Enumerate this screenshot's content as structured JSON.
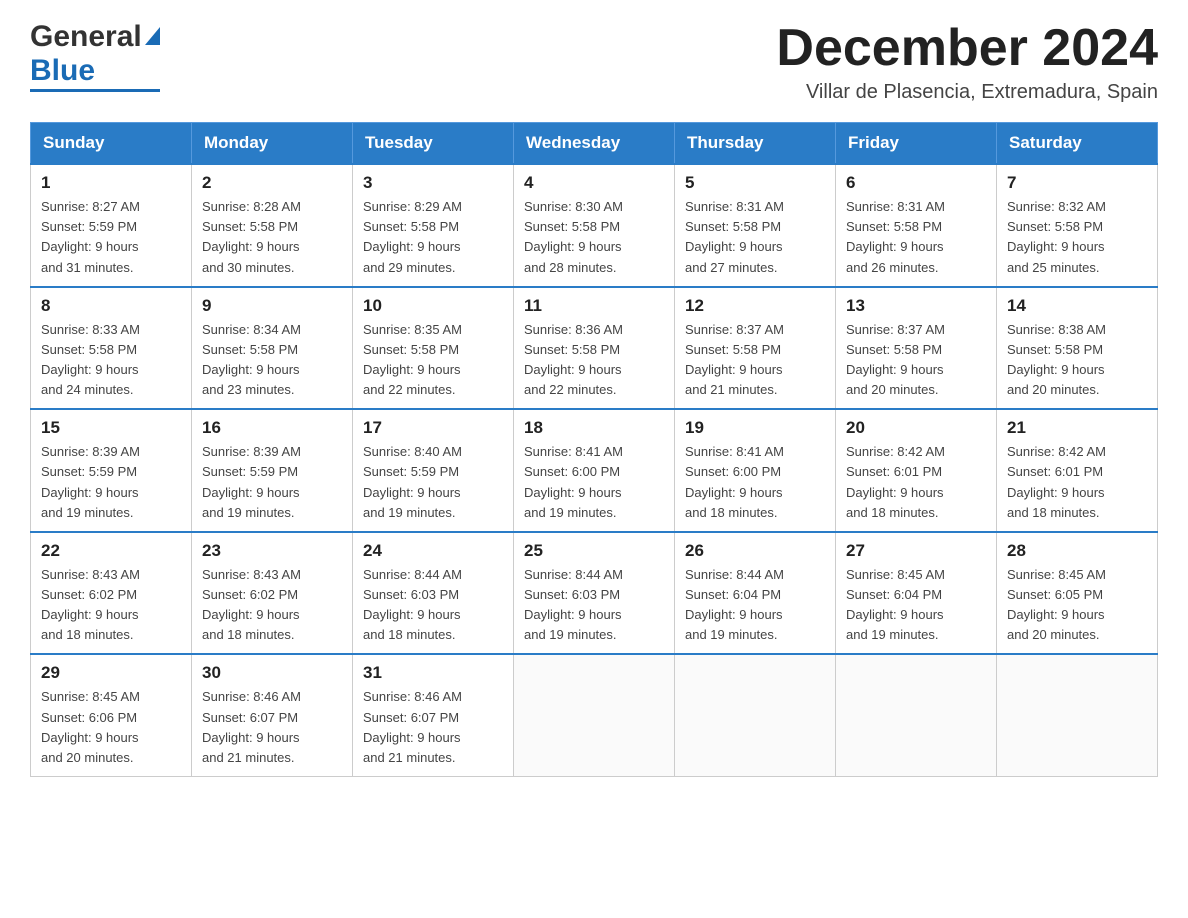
{
  "header": {
    "logo_general": "General",
    "logo_blue": "Blue",
    "month_title": "December 2024",
    "location": "Villar de Plasencia, Extremadura, Spain"
  },
  "days_of_week": [
    "Sunday",
    "Monday",
    "Tuesday",
    "Wednesday",
    "Thursday",
    "Friday",
    "Saturday"
  ],
  "weeks": [
    [
      {
        "day": "1",
        "sunrise": "8:27 AM",
        "sunset": "5:59 PM",
        "daylight": "9 hours and 31 minutes."
      },
      {
        "day": "2",
        "sunrise": "8:28 AM",
        "sunset": "5:58 PM",
        "daylight": "9 hours and 30 minutes."
      },
      {
        "day": "3",
        "sunrise": "8:29 AM",
        "sunset": "5:58 PM",
        "daylight": "9 hours and 29 minutes."
      },
      {
        "day": "4",
        "sunrise": "8:30 AM",
        "sunset": "5:58 PM",
        "daylight": "9 hours and 28 minutes."
      },
      {
        "day": "5",
        "sunrise": "8:31 AM",
        "sunset": "5:58 PM",
        "daylight": "9 hours and 27 minutes."
      },
      {
        "day": "6",
        "sunrise": "8:31 AM",
        "sunset": "5:58 PM",
        "daylight": "9 hours and 26 minutes."
      },
      {
        "day": "7",
        "sunrise": "8:32 AM",
        "sunset": "5:58 PM",
        "daylight": "9 hours and 25 minutes."
      }
    ],
    [
      {
        "day": "8",
        "sunrise": "8:33 AM",
        "sunset": "5:58 PM",
        "daylight": "9 hours and 24 minutes."
      },
      {
        "day": "9",
        "sunrise": "8:34 AM",
        "sunset": "5:58 PM",
        "daylight": "9 hours and 23 minutes."
      },
      {
        "day": "10",
        "sunrise": "8:35 AM",
        "sunset": "5:58 PM",
        "daylight": "9 hours and 22 minutes."
      },
      {
        "day": "11",
        "sunrise": "8:36 AM",
        "sunset": "5:58 PM",
        "daylight": "9 hours and 22 minutes."
      },
      {
        "day": "12",
        "sunrise": "8:37 AM",
        "sunset": "5:58 PM",
        "daylight": "9 hours and 21 minutes."
      },
      {
        "day": "13",
        "sunrise": "8:37 AM",
        "sunset": "5:58 PM",
        "daylight": "9 hours and 20 minutes."
      },
      {
        "day": "14",
        "sunrise": "8:38 AM",
        "sunset": "5:58 PM",
        "daylight": "9 hours and 20 minutes."
      }
    ],
    [
      {
        "day": "15",
        "sunrise": "8:39 AM",
        "sunset": "5:59 PM",
        "daylight": "9 hours and 19 minutes."
      },
      {
        "day": "16",
        "sunrise": "8:39 AM",
        "sunset": "5:59 PM",
        "daylight": "9 hours and 19 minutes."
      },
      {
        "day": "17",
        "sunrise": "8:40 AM",
        "sunset": "5:59 PM",
        "daylight": "9 hours and 19 minutes."
      },
      {
        "day": "18",
        "sunrise": "8:41 AM",
        "sunset": "6:00 PM",
        "daylight": "9 hours and 19 minutes."
      },
      {
        "day": "19",
        "sunrise": "8:41 AM",
        "sunset": "6:00 PM",
        "daylight": "9 hours and 18 minutes."
      },
      {
        "day": "20",
        "sunrise": "8:42 AM",
        "sunset": "6:01 PM",
        "daylight": "9 hours and 18 minutes."
      },
      {
        "day": "21",
        "sunrise": "8:42 AM",
        "sunset": "6:01 PM",
        "daylight": "9 hours and 18 minutes."
      }
    ],
    [
      {
        "day": "22",
        "sunrise": "8:43 AM",
        "sunset": "6:02 PM",
        "daylight": "9 hours and 18 minutes."
      },
      {
        "day": "23",
        "sunrise": "8:43 AM",
        "sunset": "6:02 PM",
        "daylight": "9 hours and 18 minutes."
      },
      {
        "day": "24",
        "sunrise": "8:44 AM",
        "sunset": "6:03 PM",
        "daylight": "9 hours and 18 minutes."
      },
      {
        "day": "25",
        "sunrise": "8:44 AM",
        "sunset": "6:03 PM",
        "daylight": "9 hours and 19 minutes."
      },
      {
        "day": "26",
        "sunrise": "8:44 AM",
        "sunset": "6:04 PM",
        "daylight": "9 hours and 19 minutes."
      },
      {
        "day": "27",
        "sunrise": "8:45 AM",
        "sunset": "6:04 PM",
        "daylight": "9 hours and 19 minutes."
      },
      {
        "day": "28",
        "sunrise": "8:45 AM",
        "sunset": "6:05 PM",
        "daylight": "9 hours and 20 minutes."
      }
    ],
    [
      {
        "day": "29",
        "sunrise": "8:45 AM",
        "sunset": "6:06 PM",
        "daylight": "9 hours and 20 minutes."
      },
      {
        "day": "30",
        "sunrise": "8:46 AM",
        "sunset": "6:07 PM",
        "daylight": "9 hours and 21 minutes."
      },
      {
        "day": "31",
        "sunrise": "8:46 AM",
        "sunset": "6:07 PM",
        "daylight": "9 hours and 21 minutes."
      },
      null,
      null,
      null,
      null
    ]
  ],
  "labels": {
    "sunrise_label": "Sunrise:",
    "sunset_label": "Sunset:",
    "daylight_label": "Daylight:"
  }
}
